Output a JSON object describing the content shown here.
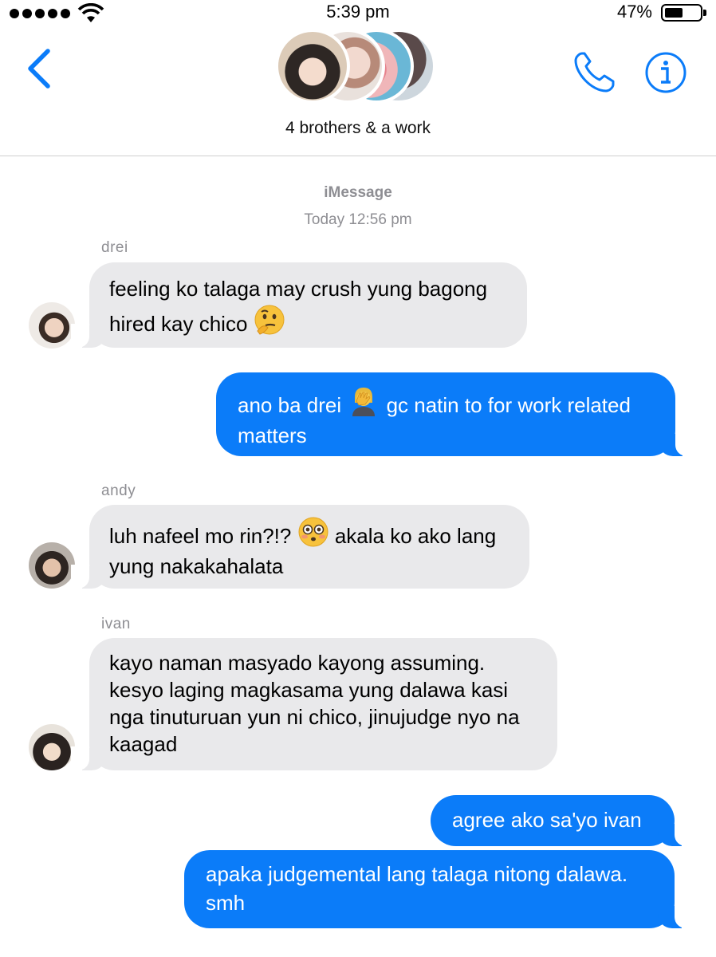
{
  "status_bar": {
    "time": "5:39 pm",
    "battery_percent": "47%",
    "battery_level": 0.47
  },
  "header": {
    "group_name": "4 brothers & a work",
    "back_icon": "chevron-left-icon",
    "call_icon": "phone-icon",
    "info_icon": "info-icon"
  },
  "meta": {
    "service": "iMessage",
    "timestamp": "Today 12:56 pm"
  },
  "messages": [
    {
      "sender": "drei",
      "direction": "incoming",
      "text": [
        "feeling ko talaga may crush yung bagong",
        "hired kay chico"
      ],
      "emoji": "thinking-face"
    },
    {
      "direction": "outgoing",
      "text_before": "ano ba drei",
      "emoji": "person-facepalming",
      "text_after": "gc natin to for work related",
      "text_line2": "matters"
    },
    {
      "sender": "andy",
      "direction": "incoming",
      "text_before": "luh nafeel mo rin?!?",
      "emoji": "flushed-face",
      "text_after": "akala ko ako lang",
      "text_line2": "yung nakakahalata"
    },
    {
      "sender": "ivan",
      "direction": "incoming",
      "text": [
        "kayo naman masyado kayong assuming.",
        "kesyo laging magkasama yung dalawa kasi",
        "nga tinuturuan yun ni chico, jinujudge nyo na",
        "kaagad"
      ]
    },
    {
      "direction": "outgoing",
      "text": [
        "agree ako sa'yo ivan"
      ]
    },
    {
      "direction": "outgoing",
      "text": [
        "apaka judgemental lang talaga nitong dalawa.",
        "smh"
      ]
    }
  ]
}
